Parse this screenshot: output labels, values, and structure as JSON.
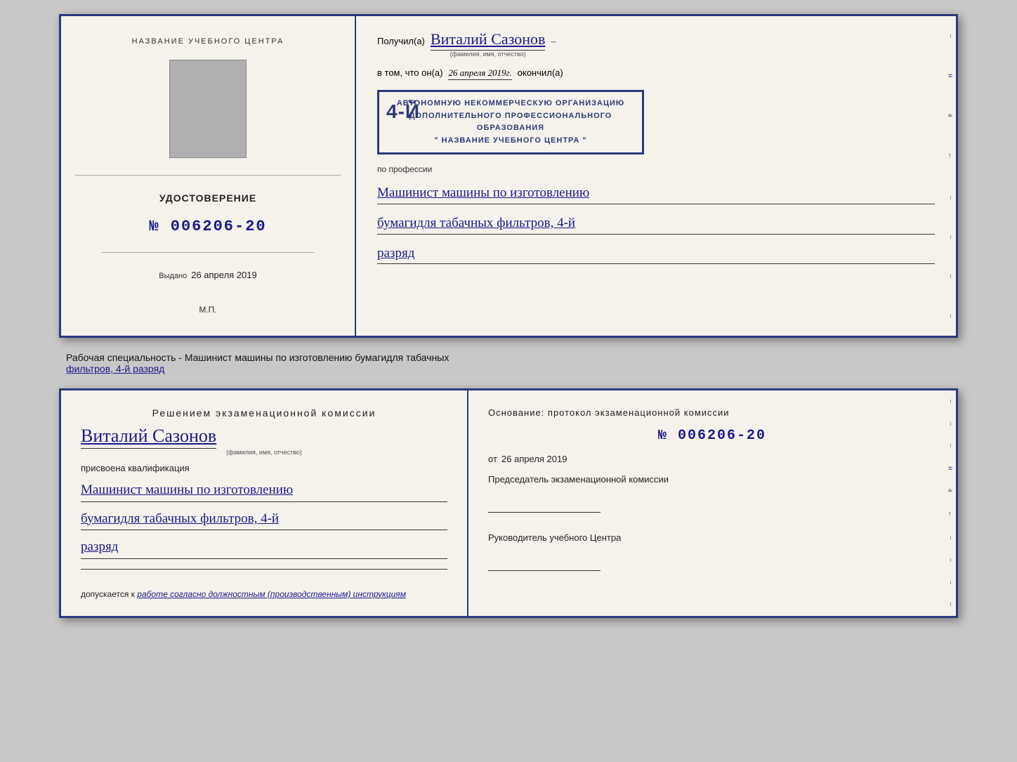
{
  "top_cert": {
    "left": {
      "section_title": "НАЗВАНИЕ УЧЕБНОГО ЦЕНТРА",
      "udost_label": "УДОСТОВЕРЕНИЕ",
      "udost_number": "№ 006206-20",
      "vydano_label": "Выдано",
      "vydano_date": "26 апреля 2019",
      "mp_label": "М.П."
    },
    "right": {
      "poluchil_label": "Получил(а)",
      "poluchil_name": "Виталий Сазонов",
      "fio_sub": "(фамилия, имя, отчество)",
      "dash": "–",
      "vtom_label": "в том, что он(а)",
      "vtom_date": "26 апреля 2019г.",
      "okonchil_label": "окончил(а)",
      "stamp_line1": "АВТОНОМНУЮ НЕКОММЕРЧЕСКУЮ ОРГАНИЗАЦИЮ",
      "stamp_line2": "ДОПОЛНИТЕЛЬНОГО ПРОФЕССИОНАЛЬНОГО ОБРАЗОВАНИЯ",
      "stamp_line3": "\" НАЗВАНИЕ УЧЕБНОГО ЦЕНТРА \"",
      "stamp_number": "4-й",
      "po_professii_label": "по профессии",
      "profession_line1": "Машинист машины по изготовлению",
      "profession_line2": "бумагидля табачных фильтров, 4-й",
      "profession_line3": "разряд"
    }
  },
  "middle": {
    "text": "Рабочая специальность - Машинист машины по изготовлению бумагидля табачных",
    "text2_underline": "фильтров, 4-й разряд"
  },
  "bottom_cert": {
    "left": {
      "resheniem_title": "Решением  экзаменационной  комиссии",
      "person_name": "Виталий Сазонов",
      "fio_sub": "(фамилия, имя, отчество)",
      "prisvonena": "присвоена квалификация",
      "qualification_line1": "Машинист машины по изготовлению",
      "qualification_line2": "бумагидля табачных фильтров, 4-й",
      "qualification_line3": "разряд",
      "dopuskaetsya": "допускается к",
      "dopusk_italic": "работе согласно должностным (производственным) инструкциям"
    },
    "right": {
      "osnovanie_label": "Основание: протокол экзаменационной комиссии",
      "protocol_number": "№  006206-20",
      "ot_label": "от",
      "ot_date": "26 апреля 2019",
      "predsedatel_label": "Председатель экзаменационной комиссии",
      "rukovoditel_label": "Руководитель учебного Центра"
    }
  },
  "edge_chars": [
    "–",
    "и",
    "а",
    "←",
    "–",
    "–",
    "–",
    "–"
  ]
}
